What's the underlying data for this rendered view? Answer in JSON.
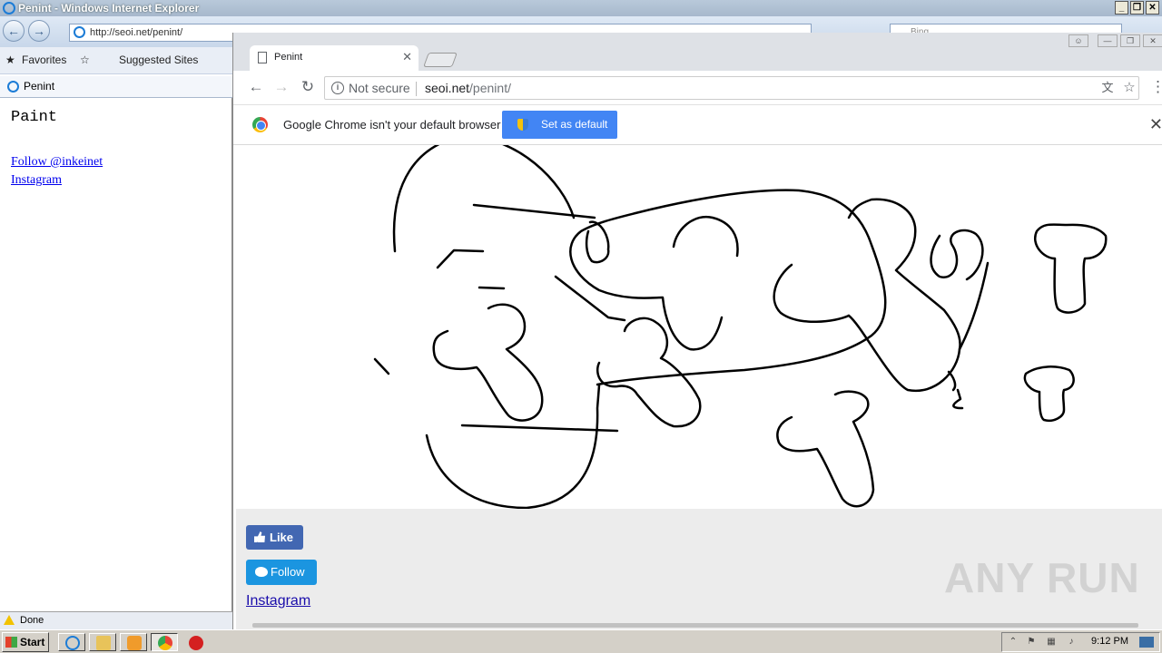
{
  "ie": {
    "window_title": "Penint - Windows Internet Explorer",
    "address": "http://seoi.net/penint/",
    "search_placeholder": "Bing",
    "favorites_label": "Favorites",
    "suggested_sites_label": "Suggested Sites",
    "tab_title": "Penint",
    "content": {
      "heading": "Paint",
      "follow_link": "Follow @inkeinet",
      "instagram_link": "Instagram"
    },
    "status_text": "Done"
  },
  "chrome": {
    "tab_title": "Penint",
    "not_secure": "Not secure",
    "url_host": "seoi.net",
    "url_path": "/penint/",
    "infobar_message": "Google Chrome isn't your default browser",
    "set_default_label": "Set as default",
    "page": {
      "like_label": "Like",
      "follow_label": "Follow",
      "instagram_label": "Instagram"
    },
    "watermark": "ANY RUN"
  },
  "taskbar": {
    "start_label": "Start",
    "clock": "9:12 PM"
  },
  "colors": {
    "fb_blue": "#4267b2",
    "twitter_blue": "#1b95e0",
    "chrome_accent": "#4285f4"
  }
}
